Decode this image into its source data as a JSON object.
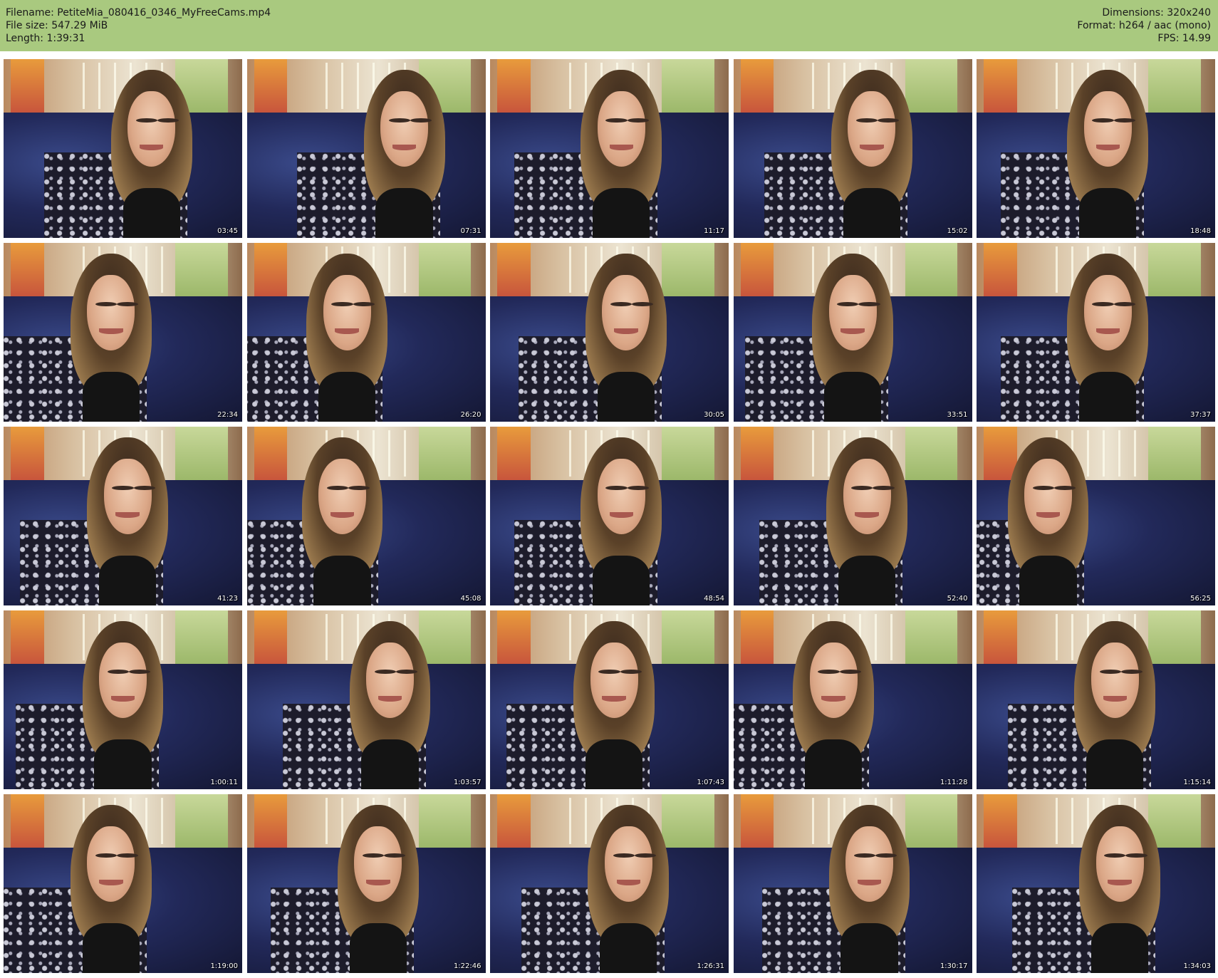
{
  "header": {
    "filename_line": "Filename: PetiteMia_080416_0346_MyFreeCams.mp4",
    "filesize_line": "File size: 547.29 MiB",
    "length_line": "Length: 1:39:31",
    "dimensions_line": "Dimensions: 320x240",
    "format_line": "Format: h264 / aac (mono)",
    "fps_line": "FPS: 14.99",
    "bar_color": "#a9c97f"
  },
  "thumbnails": [
    {
      "timestamp": "03:45"
    },
    {
      "timestamp": "07:31"
    },
    {
      "timestamp": "11:17"
    },
    {
      "timestamp": "15:02"
    },
    {
      "timestamp": "18:48"
    },
    {
      "timestamp": "22:34"
    },
    {
      "timestamp": "26:20"
    },
    {
      "timestamp": "30:05"
    },
    {
      "timestamp": "33:51"
    },
    {
      "timestamp": "37:37"
    },
    {
      "timestamp": "41:23"
    },
    {
      "timestamp": "45:08"
    },
    {
      "timestamp": "48:54"
    },
    {
      "timestamp": "52:40"
    },
    {
      "timestamp": "56:25"
    },
    {
      "timestamp": "1:00:11"
    },
    {
      "timestamp": "1:03:57"
    },
    {
      "timestamp": "1:07:43"
    },
    {
      "timestamp": "1:11:28"
    },
    {
      "timestamp": "1:15:14"
    },
    {
      "timestamp": "1:19:00"
    },
    {
      "timestamp": "1:22:46"
    },
    {
      "timestamp": "1:26:31"
    },
    {
      "timestamp": "1:30:17"
    },
    {
      "timestamp": "1:34:03"
    }
  ]
}
